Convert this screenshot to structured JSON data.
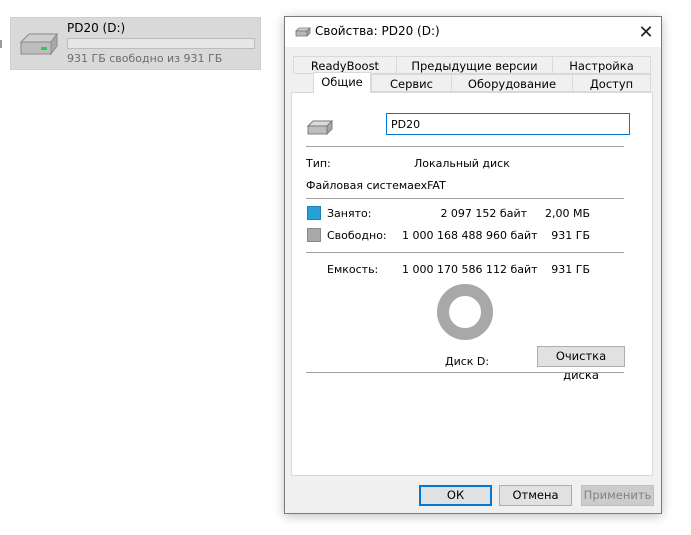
{
  "explorer": {
    "drive_title": "PD20 (D:)",
    "drive_free": "931 ГБ свободно из 931 ГБ",
    "drive_used_fraction": 0.0
  },
  "dialog": {
    "title": "Свойства: PD20 (D:)",
    "close_glyph": "✕",
    "tabs_row1": [
      "ReadyBoost",
      "Предыдущие версии",
      "Настройка"
    ],
    "tabs_row2": [
      "Общие",
      "Сервис",
      "Оборудование",
      "Доступ"
    ],
    "active_tab": "Общие",
    "volume_name": "PD20",
    "type_label": "Тип:",
    "type_value": "Локальный диск",
    "fs_label": "Файловая система:",
    "fs_value": "exFAT",
    "used_label": "Занято:",
    "used_bytes": "2 097 152 байт",
    "used_human": "2,00 МБ",
    "free_label": "Свободно:",
    "free_bytes": "1 000 168 488 960 байт",
    "free_human": "931 ГБ",
    "capacity_label": "Емкость:",
    "capacity_bytes": "1 000 170 586 112 байт",
    "capacity_human": "931 ГБ",
    "disk_label": "Диск D:",
    "cleanup_button": "Очистка диска",
    "ok_button": "ОК",
    "cancel_button": "Отмена",
    "apply_button": "Применить"
  },
  "colors": {
    "used": "#26a0da",
    "free": "#a8a8a8",
    "accent": "#0078d7"
  },
  "icons": {
    "drive": "drive-icon",
    "close": "close-icon"
  }
}
